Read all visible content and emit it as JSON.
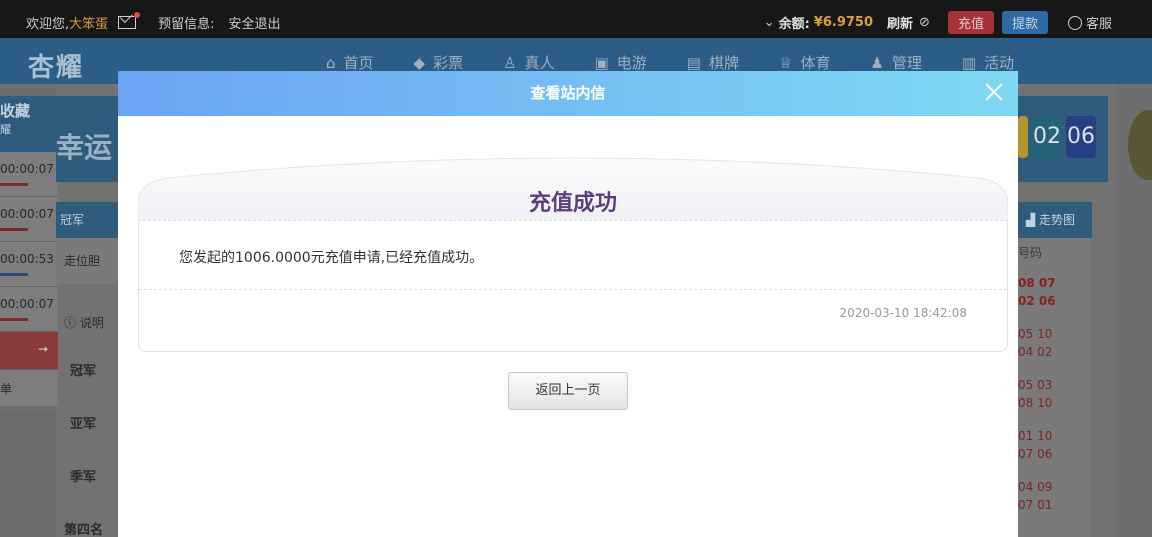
{
  "topbar": {
    "welcome": "欢迎您,",
    "username": "大笨蛋",
    "notice_label": "预留信息:",
    "logout": "安全退出",
    "balance_label": "余额:",
    "balance_value": "¥6.9750",
    "refresh": "刷新",
    "recharge": "充值",
    "withdraw": "提款",
    "service": "客服"
  },
  "nav": {
    "logo": "杏耀",
    "items": [
      {
        "label": "首页",
        "icon": "home-icon"
      },
      {
        "label": "彩票",
        "icon": "ticket-icon"
      },
      {
        "label": "真人",
        "icon": "person-icon"
      },
      {
        "label": "电游",
        "icon": "game-icon"
      },
      {
        "label": "棋牌",
        "icon": "cards-icon"
      },
      {
        "label": "体育",
        "icon": "trophy-icon"
      },
      {
        "label": "管理",
        "icon": "users-icon"
      },
      {
        "label": "活动",
        "icon": "gift-icon"
      }
    ]
  },
  "background": {
    "favorites_title": "收藏",
    "favorites_sub": "耀",
    "timers": [
      "00:00:07",
      "00:00:07",
      "00:00:53",
      "00:00:07"
    ],
    "left_arrow_label": "→",
    "left_bottom": "单",
    "lucky": "幸运",
    "tab_champion": "冠军",
    "position_label": "走位胆",
    "info_label": "说明",
    "ranks": [
      "冠军",
      "亚军",
      "季军",
      "第四名"
    ],
    "numbers": [
      "02",
      "06"
    ],
    "trend_label": "走势图",
    "code_label": "号码",
    "trend_rows": [
      [
        "08 07",
        "02 06"
      ],
      [
        "05 10",
        "04 02"
      ],
      [
        "05 03",
        "08 10"
      ],
      [
        "01 10",
        "07 06"
      ],
      [
        "04 09",
        "07 01"
      ]
    ]
  },
  "modal": {
    "title": "查看站内信",
    "card_title": "充值成功",
    "message": "您发起的1006.0000元充值申请,已经充值成功。",
    "time": "2020-03-10 18:42:08",
    "back_button": "返回上一页"
  }
}
